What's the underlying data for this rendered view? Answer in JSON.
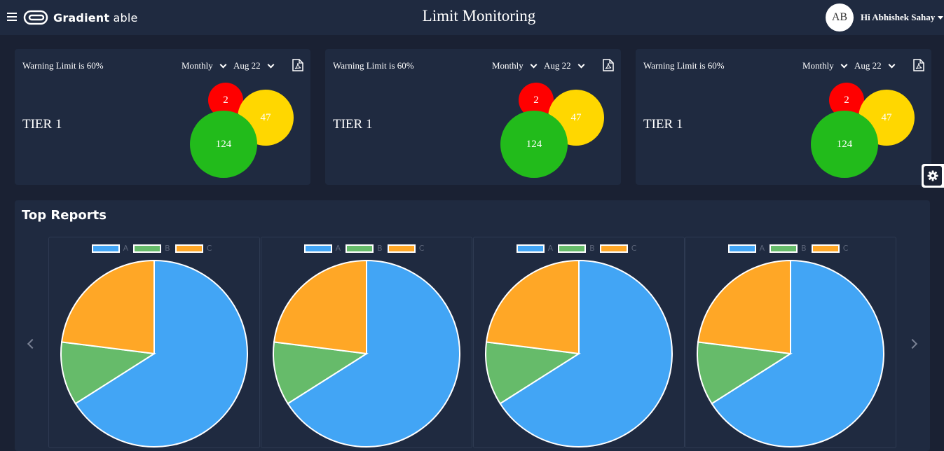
{
  "header": {
    "logo_bold": "Gradient",
    "logo_light": "able",
    "title": "Limit Monitoring",
    "avatar_initials": "AB",
    "user_greeting": "Hi Abhishek Sahay"
  },
  "cards": [
    {
      "warning": "Warning Limit is 60%",
      "period": "Monthly",
      "month": "Aug 22",
      "tier": "TIER 1",
      "red": "2",
      "yellow": "47",
      "green": "124"
    },
    {
      "warning": "Warning Limit is 60%",
      "period": "Monthly",
      "month": "Aug 22",
      "tier": "TIER 1",
      "red": "2",
      "yellow": "47",
      "green": "124"
    },
    {
      "warning": "Warning Limit is 60%",
      "period": "Monthly",
      "month": "Aug 22",
      "tier": "TIER 1",
      "red": "2",
      "yellow": "47",
      "green": "124"
    }
  ],
  "colors": {
    "red": "#ff0000",
    "yellow": "#ffd700",
    "green": "#22bb1b",
    "pie_a": "#42a5f5",
    "pie_b": "#66bb6a",
    "pie_c": "#ffa726"
  },
  "reports": {
    "title": "Top Reports",
    "legend": [
      "A",
      "B",
      "C"
    ]
  },
  "chart_data": [
    {
      "type": "pie",
      "categories": [
        "A",
        "B",
        "C"
      ],
      "values": [
        66,
        11,
        23
      ]
    },
    {
      "type": "pie",
      "categories": [
        "A",
        "B",
        "C"
      ],
      "values": [
        66,
        11,
        23
      ]
    },
    {
      "type": "pie",
      "categories": [
        "A",
        "B",
        "C"
      ],
      "values": [
        66,
        11,
        23
      ]
    },
    {
      "type": "pie",
      "categories": [
        "A",
        "B",
        "C"
      ],
      "values": [
        66,
        11,
        23
      ]
    }
  ]
}
